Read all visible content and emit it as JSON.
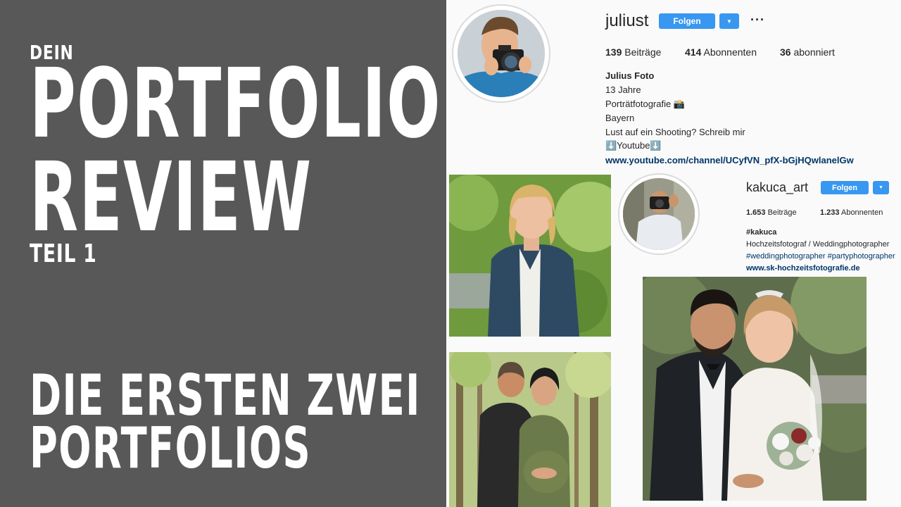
{
  "title": {
    "dein": "DEIN",
    "portfolio": "PORTFOLIO",
    "review": "REVIEW",
    "teil": "TEIL 1",
    "line1": "DIE ERSTEN ZWEI",
    "line2": "PORTFOLIOS"
  },
  "profile1": {
    "username": "juliust",
    "follow_label": "Folgen",
    "more_label": "···",
    "stats": [
      {
        "count": "139",
        "label": "Beiträge"
      },
      {
        "count": "414",
        "label": "Abonnenten"
      },
      {
        "count": "36",
        "label": "abonniert"
      }
    ],
    "bio_name": "Julius Foto",
    "bio_lines": [
      "13 Jahre",
      "Porträtfotografie 📸",
      "Bayern",
      "Lust auf ein Shooting? Schreib mir",
      "⬇️Youtube⬇️"
    ],
    "link": "www.youtube.com/channel/UCyfVN_pfX-bGjHQwlanelGw"
  },
  "profile2": {
    "username": "kakuca_art",
    "follow_label": "Folgen",
    "stats": [
      {
        "count": "1.653",
        "label": "Beiträge"
      },
      {
        "count": "1.233",
        "label": "Abonnenten"
      }
    ],
    "bio_name": "#kakuca",
    "bio_line": "Hochzeitsfotograf / Weddingphotographer",
    "hashtags": "#weddingphotographer #partyphotographer",
    "link": "www.sk-hochzeitsfotografie.de"
  },
  "colors": {
    "left_bg": "#585858",
    "follow_blue": "#3897f0",
    "link_blue": "#003569",
    "hashtag_blue": "#003569"
  }
}
